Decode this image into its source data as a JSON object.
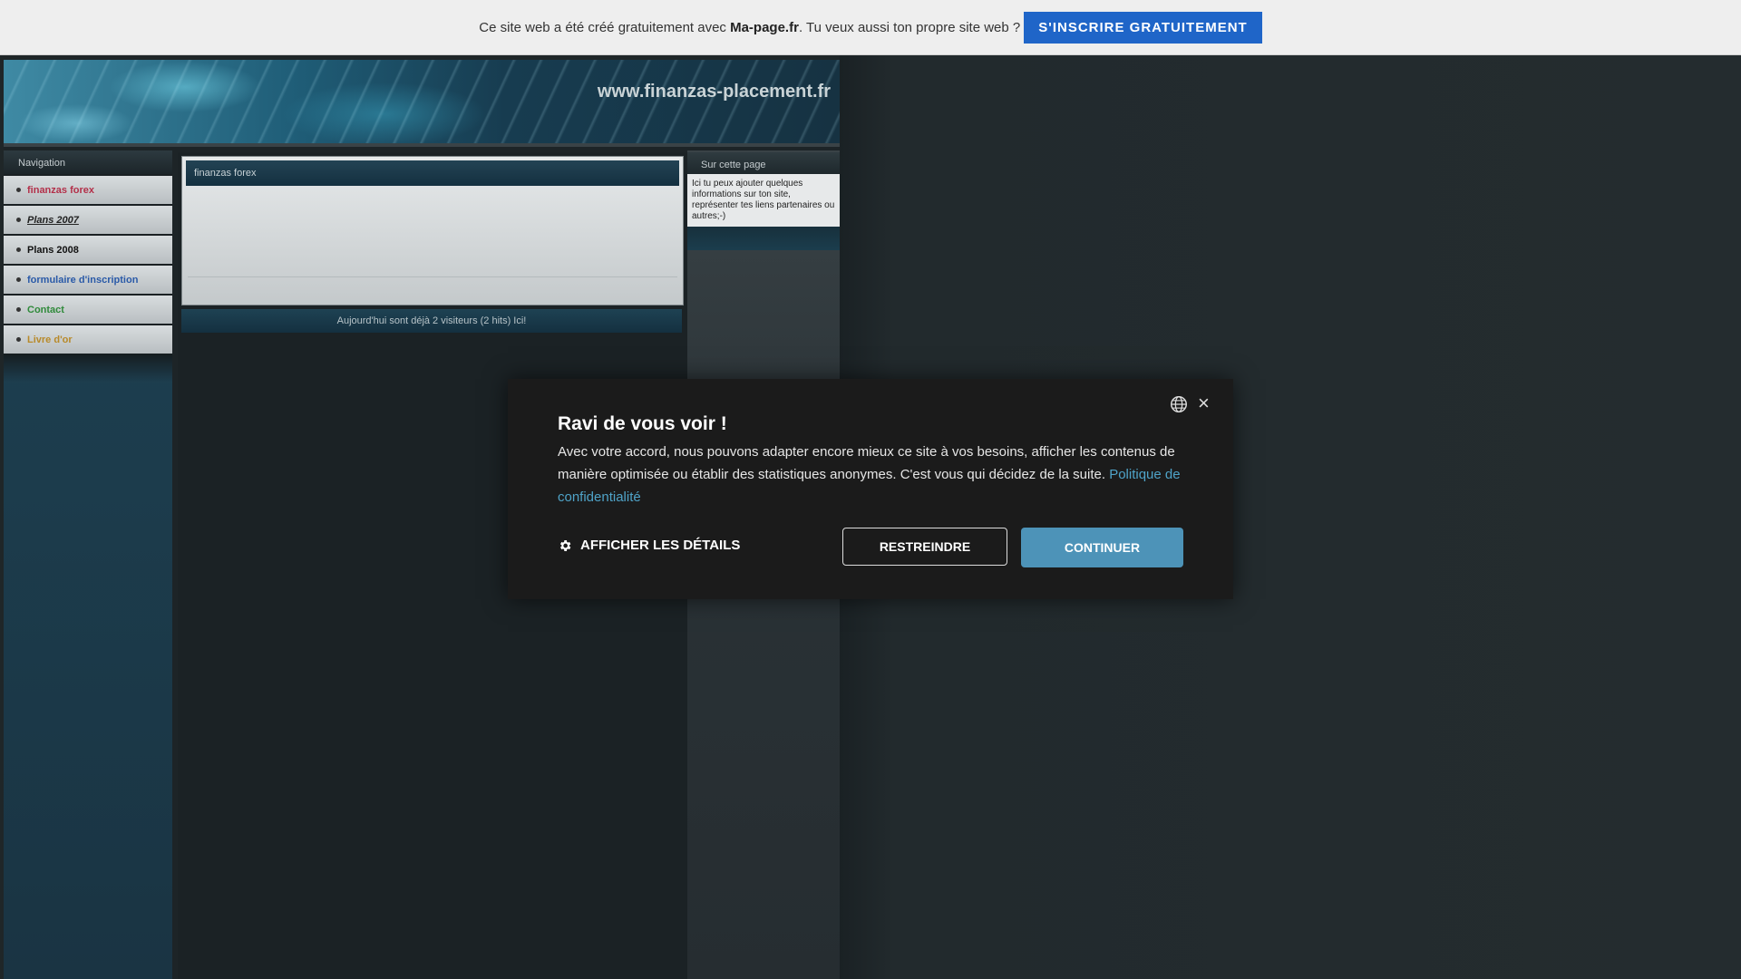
{
  "promo_bar": {
    "message_prefix": "Ce site web a été créé gratuitement avec ",
    "brand": "Ma-page.fr",
    "message_suffix": ". Tu veux aussi ton propre site web ?",
    "cta_label": "S'INSCRIRE GRATUITEMENT"
  },
  "header": {
    "site_url": "www.finanzas-placement.fr"
  },
  "navigation": {
    "title": "Navigation",
    "items": [
      {
        "label": "finanzas forex",
        "color": "#b3304a"
      },
      {
        "label": "Plans 2007",
        "color": "#222222"
      },
      {
        "label": "Plans 2008",
        "color": "#111111"
      },
      {
        "label": "formulaire d'inscription",
        "color": "#2a5aa8"
      },
      {
        "label": "Contact",
        "color": "#2f8a3a"
      },
      {
        "label": "Livre d'or",
        "color": "#b88a2a"
      }
    ]
  },
  "content": {
    "box_title": "finanzas forex",
    "visitors_text": "Aujourd'hui sont déjà 2 visiteurs (2 hits) Ici!"
  },
  "sidebar_right": {
    "title": "Sur cette page",
    "body": "Ici tu peux ajouter quelques informations sur ton site, représenter tes liens partenaires ou autres;-)"
  },
  "cookie_banner": {
    "title": "Ravi de vous voir !",
    "text": "Avec votre accord, nous pouvons adapter encore mieux ce site à vos besoins, afficher les contenus de manière optimisée ou établir des statistiques anonymes. C'est vous qui décidez de la suite. ",
    "link_label": "Politique de confidentialité",
    "details_label": "AFFICHER LES DÉTAILS",
    "restrict_label": "RESTREINDRE",
    "continue_label": "CONTINUER",
    "close_symbol": "×",
    "icons": {
      "language": "globe-icon",
      "details": "gear-icon",
      "close": "close-icon"
    }
  }
}
